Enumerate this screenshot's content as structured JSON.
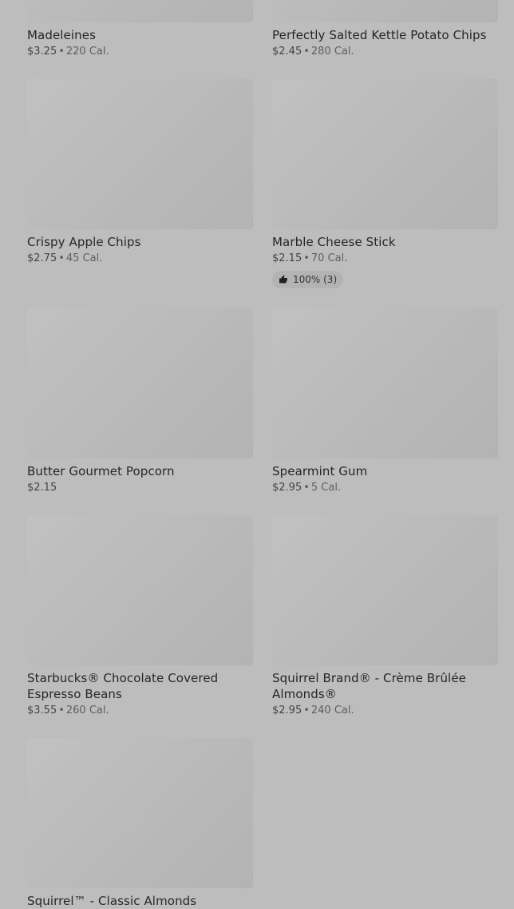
{
  "products": [
    {
      "name": "Madeleines",
      "price": "$3.25",
      "calories": "220 Cal."
    },
    {
      "name": "Perfectly Salted Kettle Potato Chips",
      "price": "$2.45",
      "calories": "280 Cal."
    },
    {
      "name": "Crispy Apple Chips",
      "price": "$2.75",
      "calories": "45 Cal."
    },
    {
      "name": "Marble Cheese Stick",
      "price": "$2.15",
      "calories": "70 Cal.",
      "rating": "100% (3)"
    },
    {
      "name": "Butter Gourmet Popcorn",
      "price": "$2.15",
      "calories": ""
    },
    {
      "name": "Spearmint Gum",
      "price": "$2.95",
      "calories": "5 Cal."
    },
    {
      "name": "Starbucks® Chocolate Covered Espresso Beans",
      "price": "$3.55",
      "calories": "260 Cal."
    },
    {
      "name": "Squirrel Brand® - Crème Brûlée Almonds®",
      "price": "$2.95",
      "calories": "240 Cal."
    },
    {
      "name": "Squirrel™ - Classic Almonds",
      "price": "",
      "calories": ""
    }
  ],
  "icons": {
    "rating": "thumbs-up-icon"
  }
}
